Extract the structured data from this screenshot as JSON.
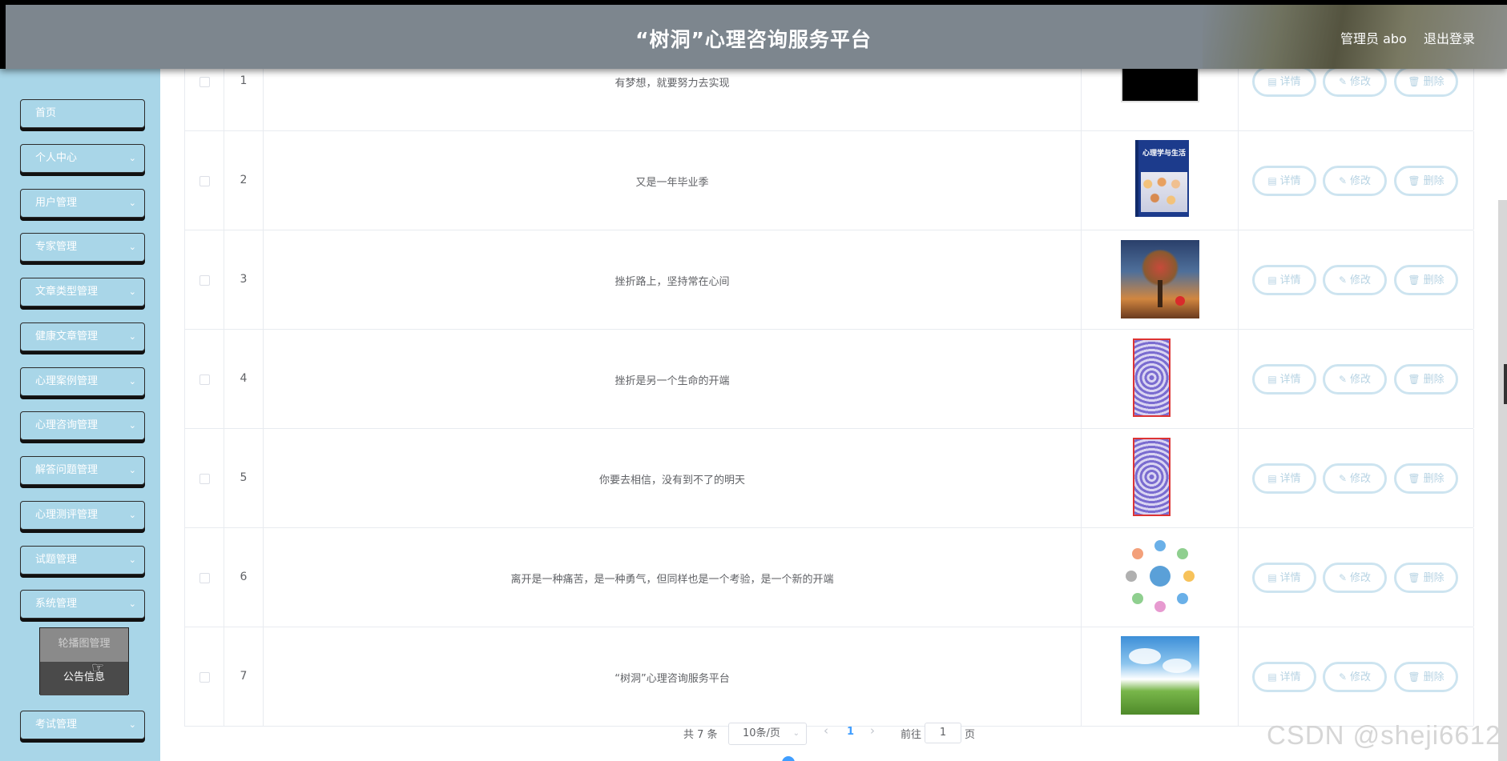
{
  "header": {
    "title": "“树洞”心理咨询服务平台",
    "admin_label": "管理员 abo",
    "logout_label": "退出登录"
  },
  "sidebar": {
    "items": [
      {
        "label": "首页"
      },
      {
        "label": "个人中心"
      },
      {
        "label": "用户管理"
      },
      {
        "label": "专家管理"
      },
      {
        "label": "文章类型管理"
      },
      {
        "label": "健康文章管理"
      },
      {
        "label": "心理案例管理"
      },
      {
        "label": "心理咨询管理"
      },
      {
        "label": "解答问题管理"
      },
      {
        "label": "心理测评管理"
      },
      {
        "label": "试题管理"
      },
      {
        "label": "系统管理"
      },
      {
        "label": "考试管理"
      }
    ],
    "submenu": {
      "items": [
        {
          "label": "轮播图管理"
        },
        {
          "label": "公告信息"
        }
      ]
    }
  },
  "table": {
    "rows": [
      {
        "index": "1",
        "title": "有梦想，就要努力去实现"
      },
      {
        "index": "2",
        "title": "又是一年毕业季"
      },
      {
        "index": "3",
        "title": "挫折路上，坚持常在心间"
      },
      {
        "index": "4",
        "title": "挫折是另一个生命的开端"
      },
      {
        "index": "5",
        "title": "你要去相信，没有到不了的明天"
      },
      {
        "index": "6",
        "title": "离开是一种痛苦，是一种勇气，但同样也是一个考验，是一个新的开端"
      },
      {
        "index": "7",
        "title": "“树洞”心理咨询服务平台"
      }
    ],
    "actions": {
      "detail": "详情",
      "edit": "修改",
      "delete": "删除"
    },
    "book_cover_text": "心理学与生活"
  },
  "pagination": {
    "total": "共 7 条",
    "page_size": "10条/页",
    "current_page": "1",
    "goto_label": "前往",
    "goto_value": "1",
    "page_suffix": "页"
  },
  "watermark": "CSDN @sheji6612",
  "icons": {
    "chevron": "chevron-down-icon",
    "detail": "document-icon",
    "edit": "pencil-icon",
    "delete": "trash-icon"
  }
}
